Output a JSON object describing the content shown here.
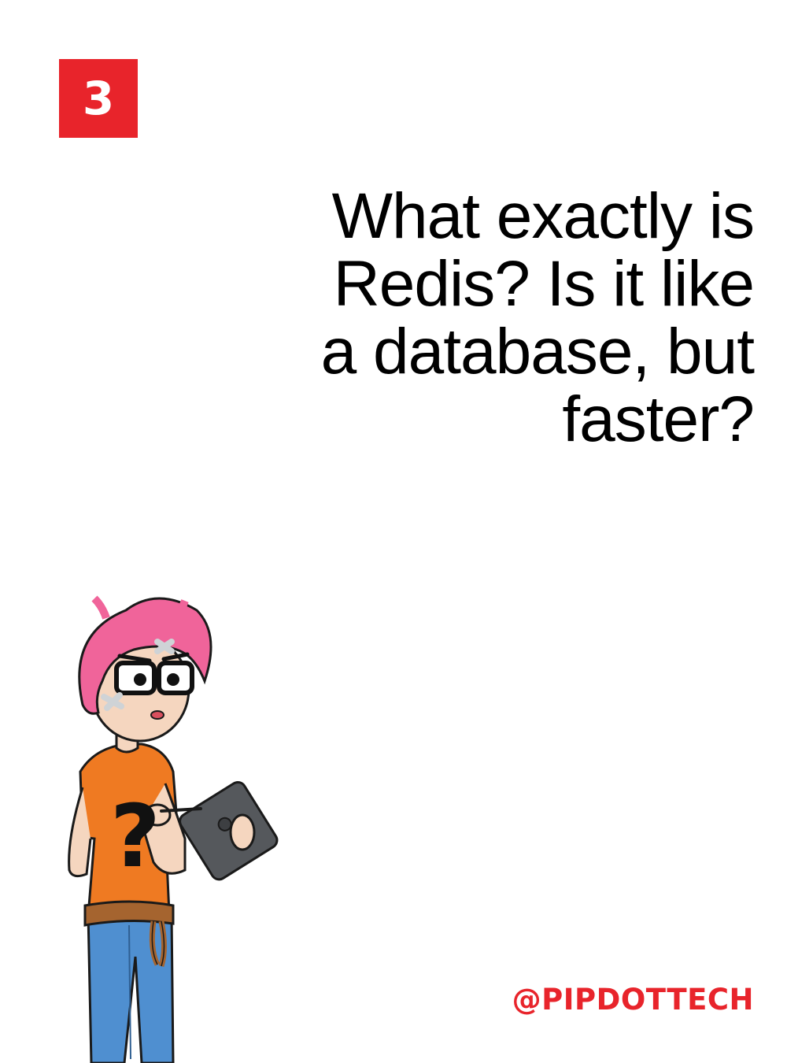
{
  "slide": {
    "number": "3",
    "accent_color": "#e8242b"
  },
  "question": {
    "lines": [
      "What exactly is",
      "Redis? Is it like",
      "a database, but",
      "faster?"
    ]
  },
  "footer": {
    "handle": "@PIPDOTTECH"
  },
  "illustration": {
    "subject": "confused-developer-with-tablet",
    "shirt_mark": "?",
    "hair_color": "#f0649a",
    "shirt_color": "#ef7a22",
    "jeans_color": "#4f8fd0",
    "tablet_color": "#55585c"
  }
}
